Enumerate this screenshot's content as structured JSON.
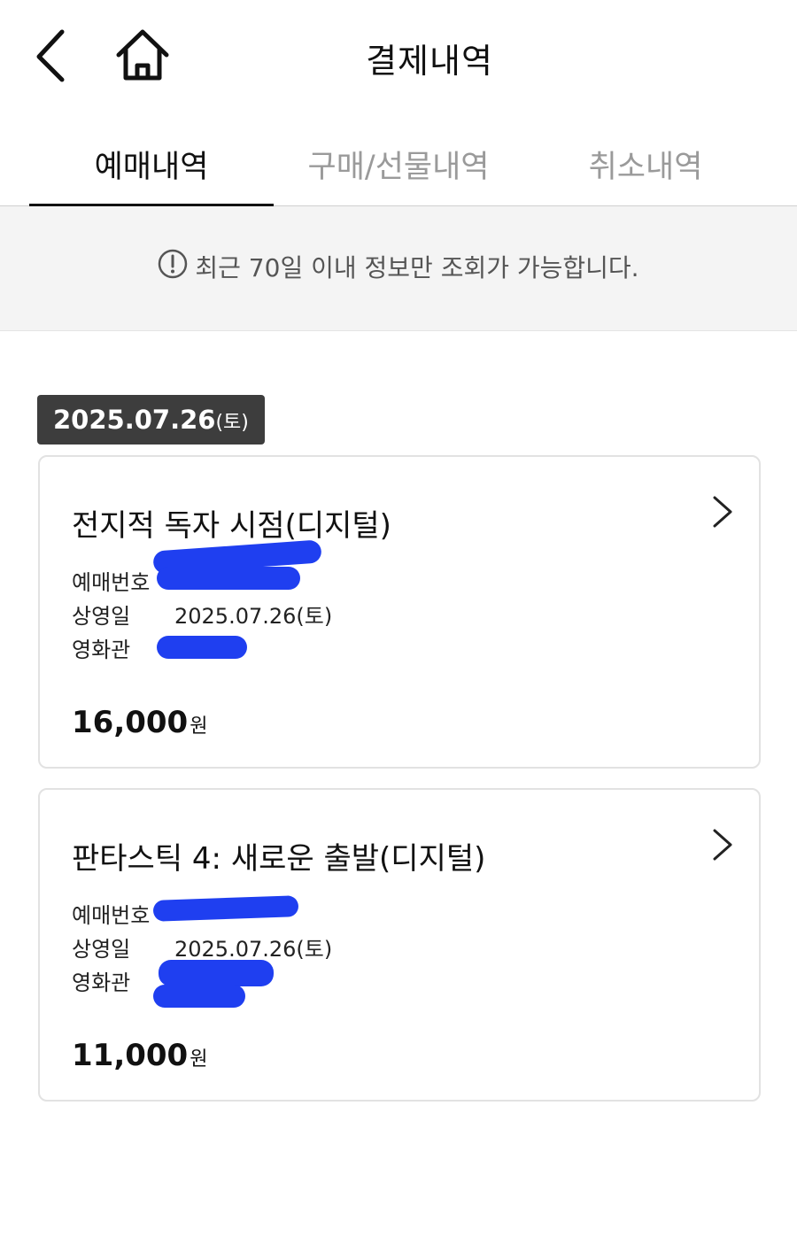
{
  "header": {
    "title": "결제내역",
    "back_icon": "chevron-left-icon",
    "home_icon": "home-icon"
  },
  "tabs": [
    {
      "label": "예매내역",
      "active": true
    },
    {
      "label": "구매/선물내역",
      "active": false
    },
    {
      "label": "취소내역",
      "active": false
    }
  ],
  "notice": {
    "icon": "info-icon",
    "text": "최근 70일 이내 정보만 조회가 가능합니다."
  },
  "date_group": {
    "date": "2025.07.26",
    "day": "(토)"
  },
  "bookings": [
    {
      "title": "전지적 독자 시점(디지털)",
      "booking_no_label": "예매번호",
      "screening_date_label": "상영일",
      "screening_date": "2025.07.26(토)",
      "theater_label": "영화관",
      "price": "16,000",
      "price_unit": "원"
    },
    {
      "title": "판타스틱 4: 새로운 출발(디지털)",
      "booking_no_label": "예매번호",
      "screening_date_label": "상영일",
      "screening_date": "2025.07.26(토)",
      "theater_label": "영화관",
      "price": "11,000",
      "price_unit": "원"
    }
  ],
  "colors": {
    "accent_dark": "#111111",
    "badge_bg": "#3d3d3d",
    "notice_bg": "#f4f4f4",
    "redaction": "#1f3ff0"
  }
}
